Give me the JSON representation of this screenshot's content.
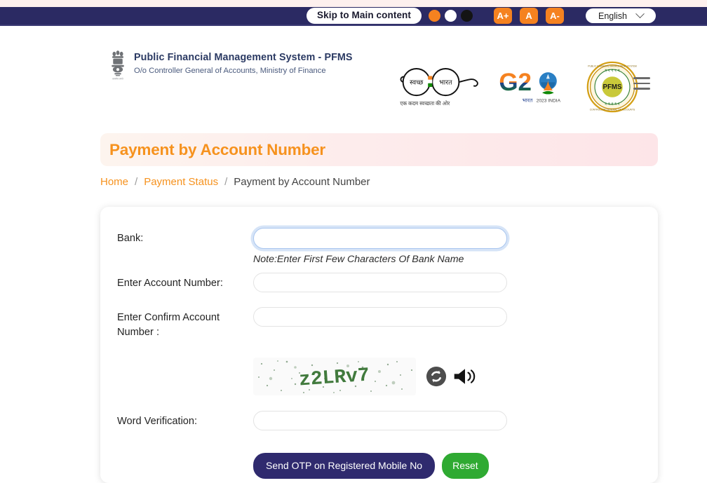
{
  "accessibility_bar": {
    "skip_label": "Skip to Main content",
    "contrast_options": [
      {
        "name": "contrast-orange",
        "color": "#f58220"
      },
      {
        "name": "contrast-white",
        "color": "#ffffff"
      },
      {
        "name": "contrast-black",
        "color": "#141414"
      }
    ],
    "font_buttons": [
      {
        "name": "font-increase",
        "label": "A+"
      },
      {
        "name": "font-normal",
        "label": "A"
      },
      {
        "name": "font-decrease",
        "label": "A-"
      }
    ],
    "language": {
      "selected": "English",
      "icon": "chevron-down-icon"
    },
    "bar_color": "#2b2a63",
    "accent_color": "#f58220"
  },
  "masthead": {
    "emblem_icon": "india-national-emblem-icon",
    "title": "Public Financial Management System - PFMS",
    "subtitle": "O/o Controller General of Accounts, Ministry of Finance",
    "title_color": "#2b3a63",
    "logos": [
      {
        "name": "swachh-bharat-logo",
        "text_left": "स्वच्छ",
        "text_right": "भारत",
        "tagline": "एक कदम स्वच्छता की ओर"
      },
      {
        "name": "g20-logo",
        "text": "G20",
        "tagline": "भारत 2023 INDIA"
      },
      {
        "name": "pfms-seal-logo",
        "text": "PFMS"
      }
    ],
    "menu_icon": "hamburger-menu-icon"
  },
  "page": {
    "title": "Payment by Account Number",
    "title_color": "#f6921e"
  },
  "breadcrumb": {
    "items": [
      {
        "label": "Home",
        "current": false
      },
      {
        "label": "Payment Status",
        "current": false
      },
      {
        "label": "Payment by Account Number",
        "current": true
      }
    ],
    "separator": "/"
  },
  "form": {
    "fields": [
      {
        "name": "bank",
        "label": "Bank:",
        "value": "",
        "placeholder": "",
        "focused": true,
        "note": "Note:Enter First Few Characters Of Bank Name"
      },
      {
        "name": "account-number",
        "label": "Enter Account Number:",
        "value": "",
        "placeholder": "",
        "focused": false
      },
      {
        "name": "confirm-account-number",
        "label": "Enter Confirm Account Number :",
        "value": "",
        "placeholder": "",
        "focused": false
      },
      {
        "name": "word-verification",
        "label": "Word Verification:",
        "value": "",
        "placeholder": "",
        "focused": false
      }
    ],
    "captcha": {
      "text": "z2LRv7",
      "refresh_icon": "refresh-captcha-icon",
      "audio_icon": "speaker-audio-icon"
    },
    "buttons": [
      {
        "name": "send-otp-button",
        "label": "Send OTP on Registered Mobile No",
        "color": "#2f2a6e"
      },
      {
        "name": "reset-button",
        "label": "Reset",
        "color": "#2faa32"
      }
    ]
  }
}
